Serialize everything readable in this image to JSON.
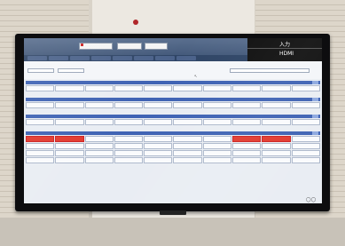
{
  "wall_sign": "",
  "overlay": {
    "title": "入力",
    "source": "HDMI",
    "info": [
      "",
      ""
    ]
  },
  "header": {
    "logo_text": "",
    "boxes": [
      "",
      "",
      ""
    ]
  },
  "filters": {
    "label1": "",
    "value1": "",
    "label2": "",
    "value2": "",
    "label3": "",
    "value3": ""
  },
  "sections": [
    {
      "rows": [
        [
          "",
          "",
          "",
          "",
          "",
          "",
          "",
          "",
          "",
          ""
        ]
      ]
    },
    {
      "rows": [
        [
          "",
          "",
          "",
          "",
          "",
          "",
          "",
          "",
          "",
          ""
        ]
      ]
    },
    {
      "rows": [
        [
          "",
          "",
          "",
          "",
          "",
          "",
          "",
          "",
          "",
          ""
        ]
      ]
    },
    {
      "rows": [
        [
          "",
          "",
          "",
          "",
          "",
          "",
          "",
          "",
          "",
          ""
        ],
        [
          "",
          "",
          "",
          "",
          "",
          "",
          "",
          "",
          "",
          ""
        ],
        [
          "",
          "",
          "",
          "",
          "",
          "",
          "",
          "",
          "",
          ""
        ],
        [
          "",
          "",
          "",
          "",
          "",
          "",
          "",
          "",
          "",
          ""
        ]
      ]
    }
  ],
  "colors": {
    "section_bar": "#3f63b4",
    "alert_cell": "#e33a2e",
    "header": "#3d5374"
  }
}
